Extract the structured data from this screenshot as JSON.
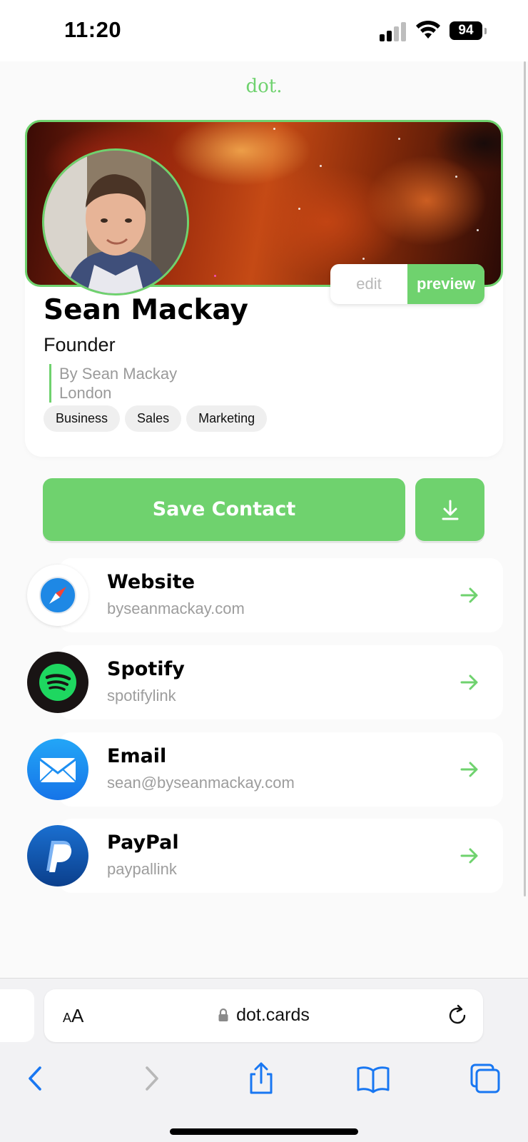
{
  "status_bar": {
    "time": "11:20",
    "battery": "94"
  },
  "brand": {
    "logo_text": "dot."
  },
  "profile": {
    "name": "Sean Mackay",
    "role": "Founder",
    "byline": "By Sean Mackay",
    "location": "London",
    "tags": [
      "Business",
      "Sales",
      "Marketing"
    ],
    "mode_toggle": {
      "edit_label": "edit",
      "preview_label": "preview",
      "active": "preview"
    }
  },
  "actions": {
    "save_contact_label": "Save Contact",
    "download_icon": "download-icon"
  },
  "links": [
    {
      "title": "Website",
      "subtitle": "byseanmackay.com",
      "icon": "safari-compass-icon"
    },
    {
      "title": "Spotify",
      "subtitle": "spotifylink",
      "icon": "spotify-icon"
    },
    {
      "title": "Email",
      "subtitle": "sean@byseanmackay.com",
      "icon": "mail-envelope-icon"
    },
    {
      "title": "PayPal",
      "subtitle": "paypallink",
      "icon": "paypal-icon"
    }
  ],
  "browser": {
    "text_size_small": "A",
    "text_size_big": "A",
    "url": "dot.cards",
    "toolbar_icons": [
      "back-icon",
      "forward-icon",
      "share-icon",
      "bookmarks-icon",
      "tabs-icon"
    ]
  },
  "colors": {
    "accent": "#6fd26e",
    "muted_text": "#9d9d9d",
    "page_background": "#fafafa"
  }
}
